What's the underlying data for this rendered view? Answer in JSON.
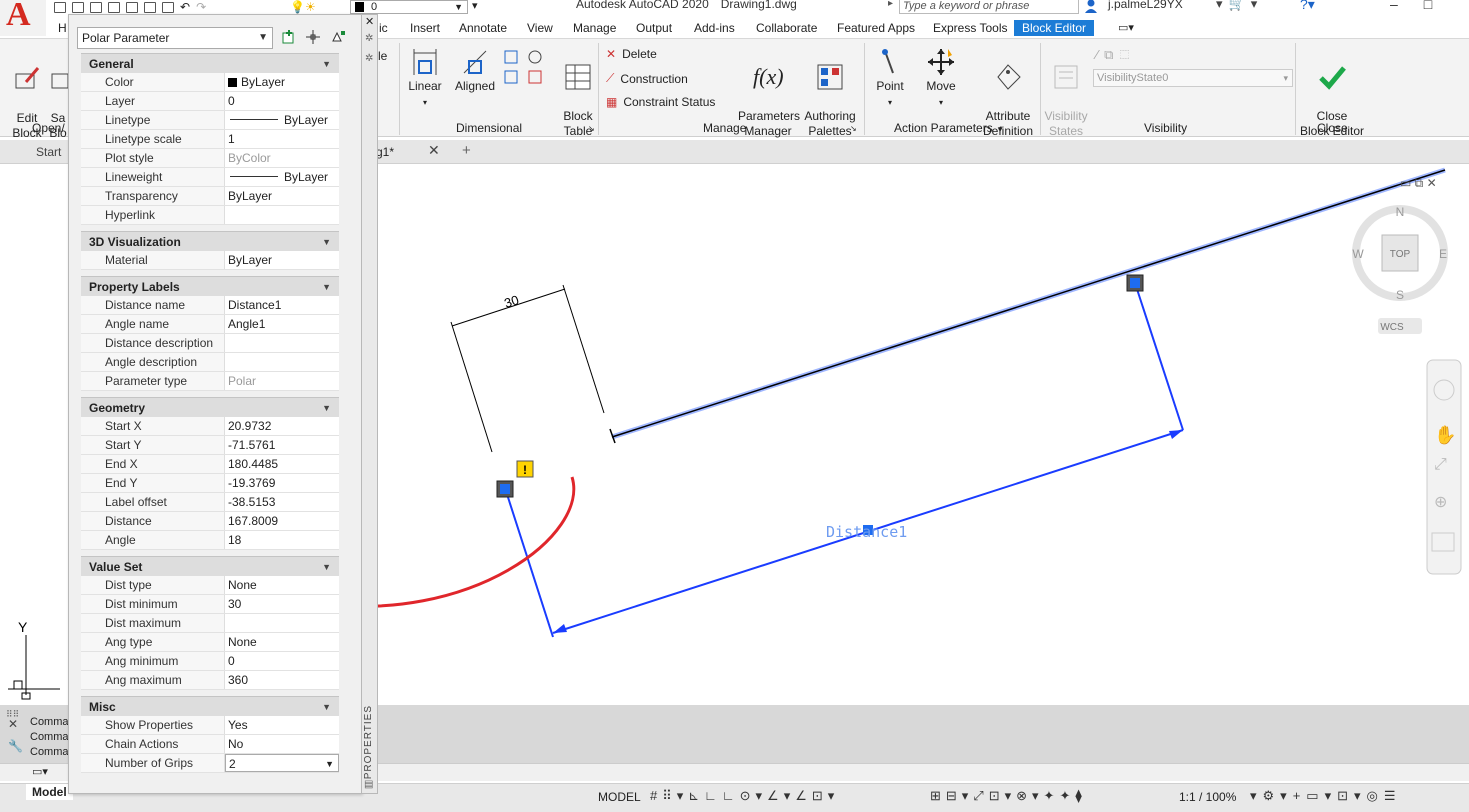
{
  "app": {
    "title": "Autodesk AutoCAD 2020",
    "file": "Drawing1.dwg",
    "search_placeholder": "Type a keyword or phrase",
    "user": "j.palmeL29YX",
    "layer_value": "0"
  },
  "ribbon_tabs": [
    "H",
    "ic",
    "Insert",
    "Annotate",
    "View",
    "Manage",
    "Output",
    "Add-ins",
    "Collaborate",
    "Featured Apps",
    "Express Tools",
    "Block Editor"
  ],
  "ribbon": {
    "open_save": {
      "edit": "Edit\nBlock",
      "save": "Sa\nBlo",
      "panel": "Open/"
    },
    "dimensional": {
      "linear": "Linear",
      "aligned": "Aligned",
      "partial": "le",
      "panel": "Dimensional"
    },
    "manage": {
      "block_table": "Block\nTable",
      "delete": "Delete",
      "construction": "Construction",
      "constraint_status": "Constraint Status",
      "param_mgr": "Parameters\nManager",
      "authoring": "Authoring\nPalettes",
      "panel": "Manage"
    },
    "action": {
      "point": "Point",
      "move": "Move",
      "attr": "Attribute\nDefinition",
      "panel": "Action Parameters"
    },
    "visibility": {
      "states": "Visibility\nStates",
      "dropdown": "VisibilityState0",
      "panel": "Visibility"
    },
    "close": {
      "button": "Close\nBlock Editor",
      "panel": "Close"
    }
  },
  "file_tabs": {
    "start": "Start",
    "drawing": "g1*"
  },
  "properties": {
    "object_type": "Polar Parameter",
    "palette_label": "PROPERTIES",
    "sections": [
      {
        "name": "General",
        "rows": [
          [
            "Color",
            "ByLayer"
          ],
          [
            "Layer",
            "0"
          ],
          [
            "Linetype",
            "ByLayer"
          ],
          [
            "Linetype scale",
            "1"
          ],
          [
            "Plot style",
            "ByColor"
          ],
          [
            "Lineweight",
            "ByLayer"
          ],
          [
            "Transparency",
            "ByLayer"
          ],
          [
            "Hyperlink",
            ""
          ]
        ]
      },
      {
        "name": "3D Visualization",
        "rows": [
          [
            "Material",
            "ByLayer"
          ]
        ]
      },
      {
        "name": "Property Labels",
        "rows": [
          [
            "Distance name",
            "Distance1"
          ],
          [
            "Angle name",
            "Angle1"
          ],
          [
            "Distance description",
            ""
          ],
          [
            "Angle description",
            ""
          ],
          [
            "Parameter type",
            "Polar"
          ]
        ]
      },
      {
        "name": "Geometry",
        "rows": [
          [
            "Start X",
            "20.9732"
          ],
          [
            "Start Y",
            "-71.5761"
          ],
          [
            "End X",
            "180.4485"
          ],
          [
            "End Y",
            "-19.3769"
          ],
          [
            "Label offset",
            "-38.5153"
          ],
          [
            "Distance",
            "167.8009"
          ],
          [
            "Angle",
            "18"
          ]
        ]
      },
      {
        "name": "Value Set",
        "rows": [
          [
            "Dist type",
            "None"
          ],
          [
            "Dist minimum",
            "30"
          ],
          [
            "Dist maximum",
            ""
          ],
          [
            "Ang type",
            "None"
          ],
          [
            "Ang minimum",
            "0"
          ],
          [
            "Ang maximum",
            "360"
          ]
        ]
      },
      {
        "name": "Misc",
        "rows": [
          [
            "Show Properties",
            "Yes"
          ],
          [
            "Chain Actions",
            "No"
          ],
          [
            "Number of Grips",
            "2"
          ]
        ]
      }
    ]
  },
  "canvas": {
    "dim_text": "30",
    "param_label": "Distance1",
    "viewcube": {
      "n": "N",
      "s": "S",
      "e": "E",
      "w": "W",
      "top": "TOP",
      "wcs": "WCS"
    },
    "ucs_y": "Y"
  },
  "command": {
    "lines": [
      "Comma",
      "Comma",
      "Comma"
    ]
  },
  "layout_tabs": {
    "model": "Model"
  },
  "status": {
    "model": "MODEL",
    "scale": "1:1 / 100%"
  },
  "colors": {
    "accent": "#1c7cd6",
    "param_blue": "#1a3cff",
    "arrow_red": "#e0262b"
  }
}
